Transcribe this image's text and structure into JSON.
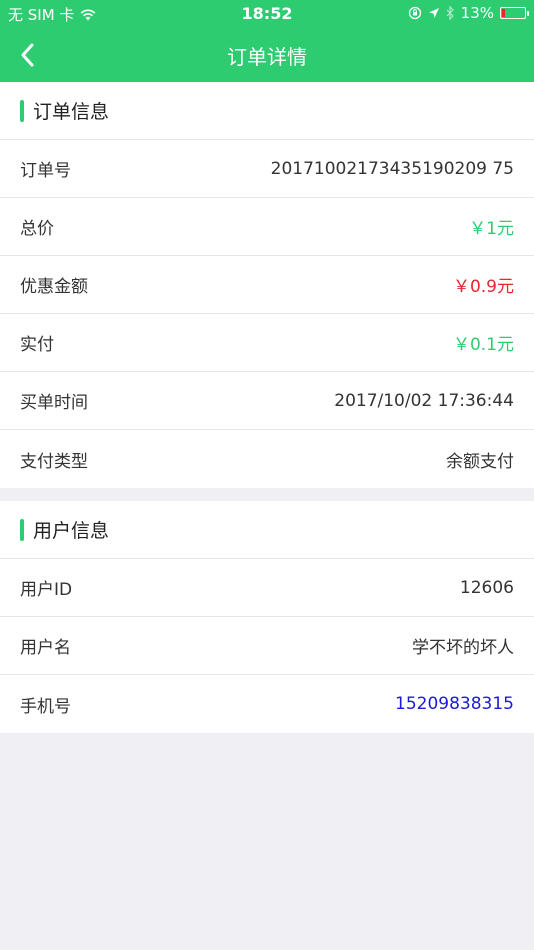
{
  "status_bar": {
    "carrier": "无 SIM 卡",
    "time": "18:52",
    "battery_percent": "13%",
    "battery_level": 0.13,
    "icons": [
      "wifi-icon",
      "lock-rotation-icon",
      "location-icon",
      "bluetooth-icon",
      "battery-icon"
    ]
  },
  "nav": {
    "title": "订单详情",
    "back_icon": "chevron-left-icon"
  },
  "colors": {
    "brand_green": "#2ecc71",
    "price_green": "#2ecc71",
    "discount_red": "#e8262e",
    "phone_blue": "#1b1bd6",
    "background": "#efeff4"
  },
  "order_info": {
    "title": "订单信息",
    "rows": [
      {
        "label": "订单号",
        "value": "20171002173435190209 75"
      },
      {
        "label": "总价",
        "value": "￥1元"
      },
      {
        "label": "优惠金额",
        "value": "￥0.9元"
      },
      {
        "label": "实付",
        "value": "￥0.1元"
      },
      {
        "label": "买单时间",
        "value": "2017/10/02 17:36:44"
      },
      {
        "label": "支付类型",
        "value": "余额支付"
      }
    ]
  },
  "user_info": {
    "title": "用户信息",
    "rows": [
      {
        "label": "用户ID",
        "value": "12606"
      },
      {
        "label": "用户名",
        "value": "学不坏的坏人"
      },
      {
        "label": "手机号",
        "value": "15209838315"
      }
    ]
  }
}
